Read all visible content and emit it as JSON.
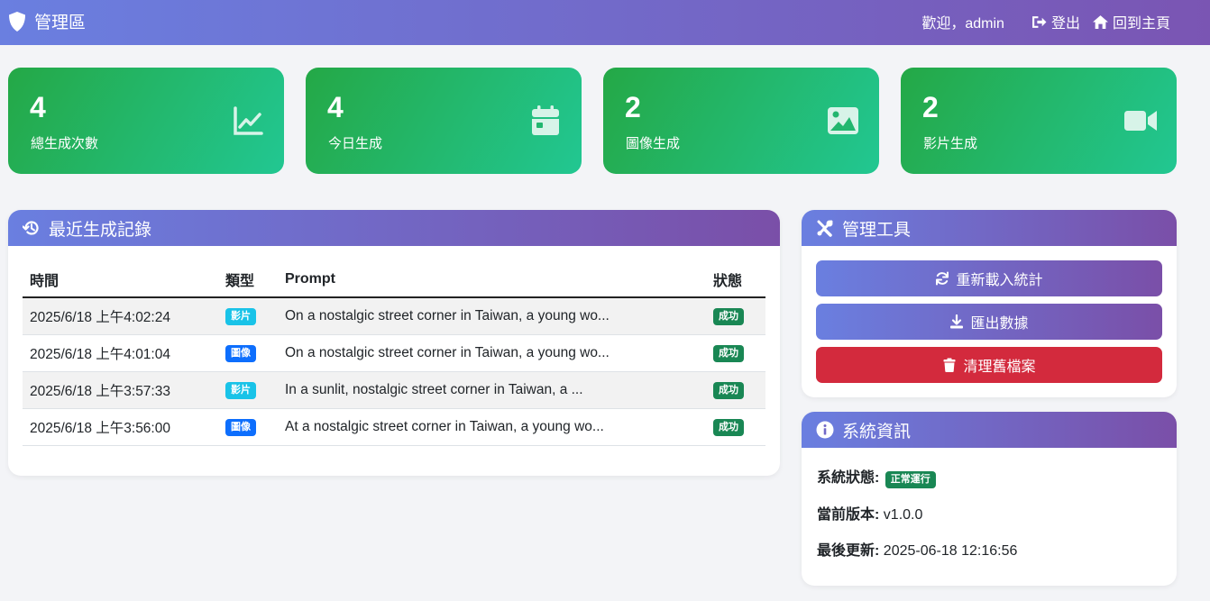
{
  "header": {
    "brand": "管理區",
    "welcome": "歡迎，admin",
    "logout_label": "登出",
    "home_label": "回到主頁"
  },
  "stats": [
    {
      "value": "4",
      "label": "總生成次數",
      "icon": "chart-line-icon"
    },
    {
      "value": "4",
      "label": "今日生成",
      "icon": "calendar-icon"
    },
    {
      "value": "2",
      "label": "圖像生成",
      "icon": "image-icon"
    },
    {
      "value": "2",
      "label": "影片生成",
      "icon": "video-icon"
    }
  ],
  "recent": {
    "title": "最近生成記錄",
    "columns": [
      "時間",
      "類型",
      "Prompt",
      "狀態"
    ],
    "rows": [
      {
        "time": "2025/6/18 上午4:02:24",
        "type": "影片",
        "prompt": "On a nostalgic street corner in Taiwan, a young wo...",
        "status": "成功"
      },
      {
        "time": "2025/6/18 上午4:01:04",
        "type": "圖像",
        "prompt": "On a nostalgic street corner in Taiwan, a young wo...",
        "status": "成功"
      },
      {
        "time": "2025/6/18 上午3:57:33",
        "type": "影片",
        "prompt": "In a sunlit, nostalgic street corner in Taiwan, a ...",
        "status": "成功"
      },
      {
        "time": "2025/6/18 上午3:56:00",
        "type": "圖像",
        "prompt": "At a nostalgic street corner in Taiwan, a young wo...",
        "status": "成功"
      }
    ]
  },
  "tools": {
    "title": "管理工具",
    "reload_label": "重新載入統計",
    "export_label": "匯出數據",
    "cleanup_label": "清理舊檔案"
  },
  "sysinfo": {
    "title": "系統資訊",
    "status_label": "系統狀態:",
    "status_value": "正常運行",
    "version_label": "當前版本:",
    "version_value": "v1.0.0",
    "updated_label": "最後更新:",
    "updated_value": "2025-06-18 12:16:56"
  },
  "colors": {
    "header_gradient": [
      "#6a7fe0",
      "#7a55b3"
    ],
    "stat_gradient": [
      "#24a846",
      "#22c792"
    ],
    "danger": "#d32a3d",
    "badge_video": "#19c3e8",
    "badge_image": "#0d6efd",
    "badge_success": "#198754"
  }
}
